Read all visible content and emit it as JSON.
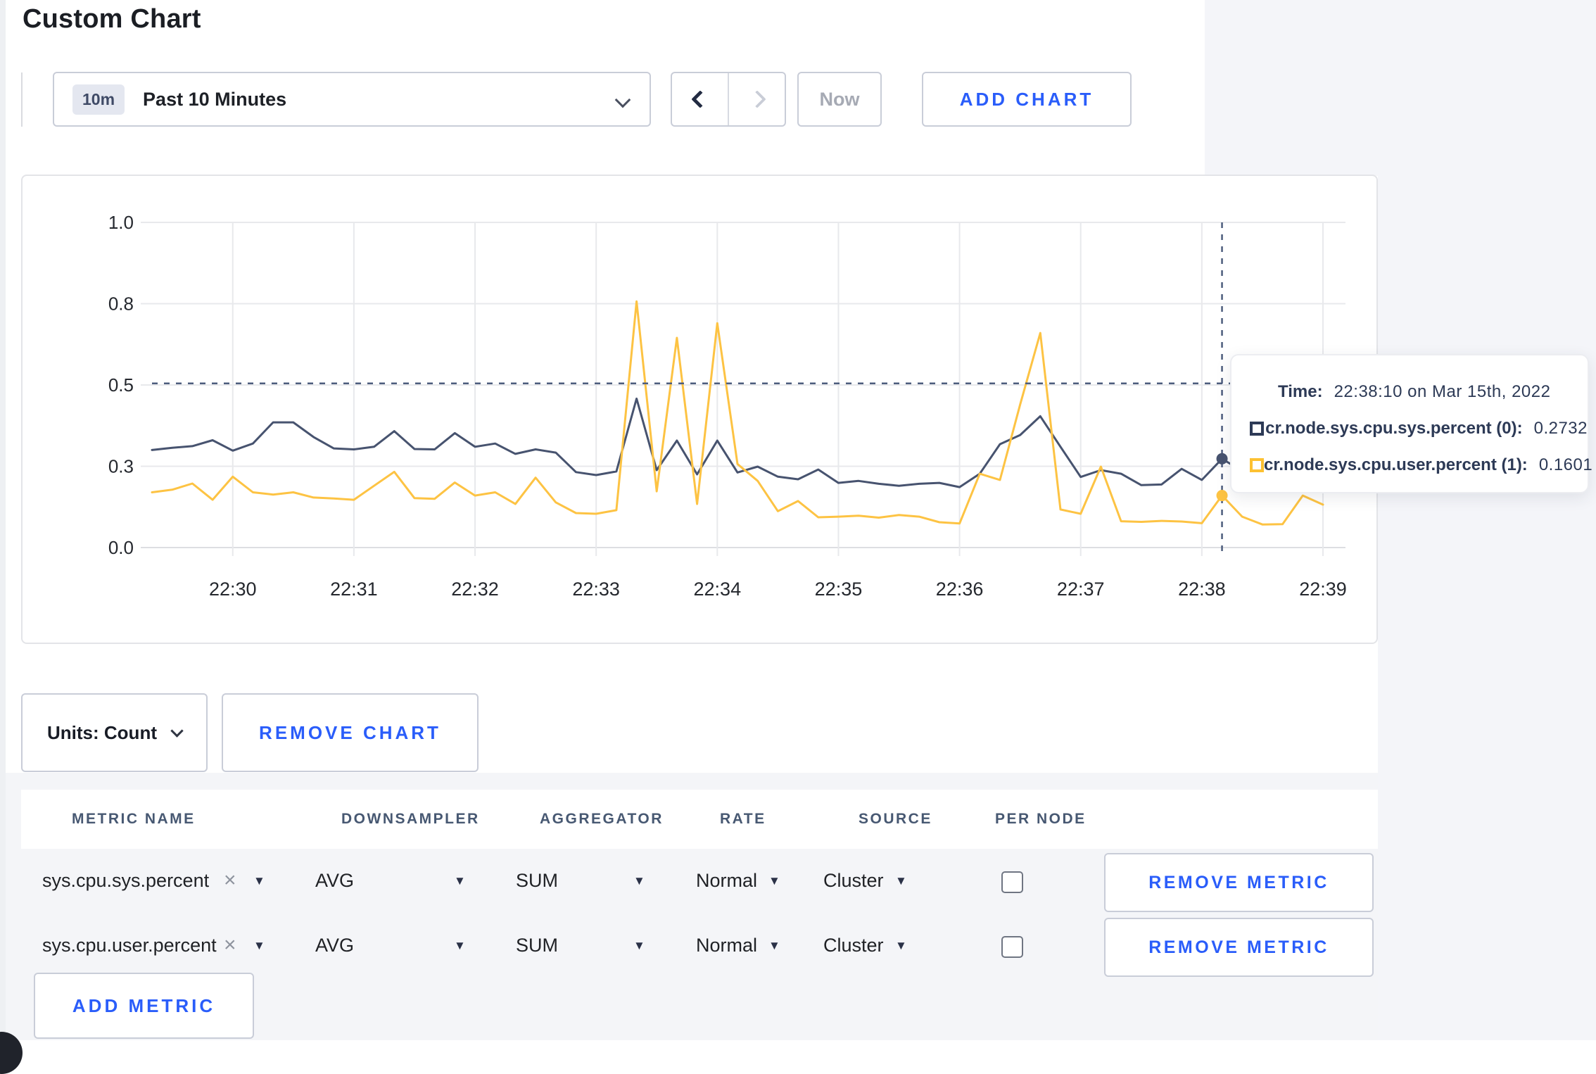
{
  "page": {
    "title": "Custom Chart"
  },
  "colors": {
    "accent_blue": "#2a5dfa",
    "series_sys": "#47536f",
    "series_user": "#fdc343",
    "tooltip_text": "#2d3a56",
    "panel_gray": "#f4f5f8",
    "grid_line": "#e8e9ec"
  },
  "icons": {
    "select_caret": "▼",
    "clear": "×",
    "chevron_down": "chevron-down",
    "pager_prev": "chevron-left",
    "pager_next": "chevron-right"
  },
  "toolbar": {
    "range_badge": "10m",
    "range_label": "Past 10 Minutes",
    "now_label": "Now",
    "add_chart_label": "ADD CHART"
  },
  "chart_data": {
    "type": "line",
    "title": "",
    "xlabel": "",
    "ylabel": "",
    "ylim": [
      0,
      1
    ],
    "grid": true,
    "x_start": "22:29:20",
    "x_step_seconds": 10,
    "x_tick_labels": [
      "22:30",
      "22:31",
      "22:32",
      "22:33",
      "22:34",
      "22:35",
      "22:36",
      "22:37",
      "22:38",
      "22:39"
    ],
    "y_tick_labels": [
      "1.0",
      "0.8",
      "0.5",
      "0.3",
      "0.0"
    ],
    "y_tick_values": [
      1.0,
      0.75,
      0.5,
      0.25,
      0.0
    ],
    "series": [
      {
        "name": "cr.node.sys.cpu.sys.percent (0)",
        "color": "#47536f",
        "values": [
          0.3,
          0.307,
          0.312,
          0.33,
          0.298,
          0.32,
          0.385,
          0.385,
          0.34,
          0.305,
          0.302,
          0.31,
          0.358,
          0.303,
          0.302,
          0.352,
          0.31,
          0.32,
          0.288,
          0.302,
          0.292,
          0.232,
          0.223,
          0.234,
          0.458,
          0.238,
          0.329,
          0.225,
          0.329,
          0.231,
          0.249,
          0.218,
          0.21,
          0.24,
          0.199,
          0.205,
          0.196,
          0.19,
          0.196,
          0.199,
          0.186,
          0.227,
          0.318,
          0.346,
          0.404,
          0.31,
          0.217,
          0.238,
          0.227,
          0.192,
          0.194,
          0.242,
          0.208,
          0.2732,
          0.235,
          0.215,
          0.22,
          0.26,
          0.3
        ]
      },
      {
        "name": "cr.node.sys.cpu.user.percent (1)",
        "color": "#fdc343",
        "values": [
          0.17,
          0.178,
          0.197,
          0.147,
          0.218,
          0.17,
          0.163,
          0.17,
          0.154,
          0.151,
          0.147,
          0.19,
          0.233,
          0.152,
          0.15,
          0.2,
          0.16,
          0.17,
          0.134,
          0.215,
          0.139,
          0.106,
          0.104,
          0.115,
          0.757,
          0.173,
          0.645,
          0.134,
          0.69,
          0.257,
          0.205,
          0.112,
          0.143,
          0.093,
          0.095,
          0.098,
          0.092,
          0.1,
          0.095,
          0.078,
          0.074,
          0.227,
          0.208,
          0.44,
          0.66,
          0.117,
          0.104,
          0.249,
          0.081,
          0.079,
          0.082,
          0.08,
          0.075,
          0.1601,
          0.095,
          0.071,
          0.072,
          0.16,
          0.132
        ]
      }
    ],
    "crosshair": {
      "index": 53,
      "time": "22:38:10",
      "hline_value": 0.505
    },
    "legend_position": "tooltip"
  },
  "tooltip": {
    "time_label": "Time:",
    "time_value": "22:38:10 on Mar 15th, 2022",
    "series": [
      {
        "label": "cr.node.sys.cpu.sys.percent (0):",
        "value": "0.2732",
        "swatch": "#2d3a56"
      },
      {
        "label": "cr.node.sys.cpu.user.percent (1):",
        "value": "0.1601",
        "swatch": "#fdc132"
      }
    ]
  },
  "chart_controls": {
    "units_label": "Units: Count",
    "remove_chart_label": "REMOVE CHART"
  },
  "table": {
    "headers": [
      "METRIC NAME",
      "DOWNSAMPLER",
      "AGGREGATOR",
      "RATE",
      "SOURCE",
      "PER NODE"
    ],
    "rows": [
      {
        "metric": "sys.cpu.sys.percent",
        "downsampler": "AVG",
        "aggregator": "SUM",
        "rate": "Normal",
        "source": "Cluster",
        "per_node_checked": false,
        "remove_label": "REMOVE METRIC"
      },
      {
        "metric": "sys.cpu.user.percent",
        "downsampler": "AVG",
        "aggregator": "SUM",
        "rate": "Normal",
        "source": "Cluster",
        "per_node_checked": false,
        "remove_label": "REMOVE METRIC"
      }
    ],
    "add_metric_label": "ADD METRIC"
  }
}
